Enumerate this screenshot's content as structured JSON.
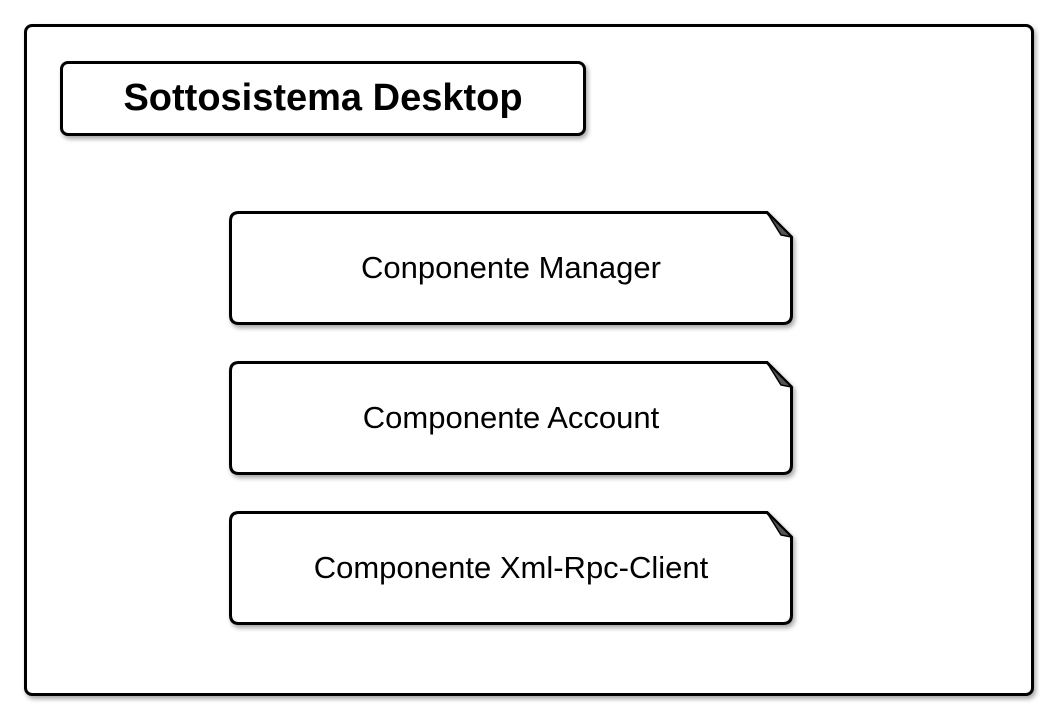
{
  "diagram": {
    "title": "Sottosistema Desktop",
    "components": [
      {
        "label": "Conponente Manager"
      },
      {
        "label": "Componente Account"
      },
      {
        "label": "Componente Xml-Rpc-Client"
      }
    ]
  },
  "colors": {
    "stroke": "#000000",
    "fill": "#ffffff"
  },
  "icons": {
    "component_corner": "folded-corner-icon"
  }
}
